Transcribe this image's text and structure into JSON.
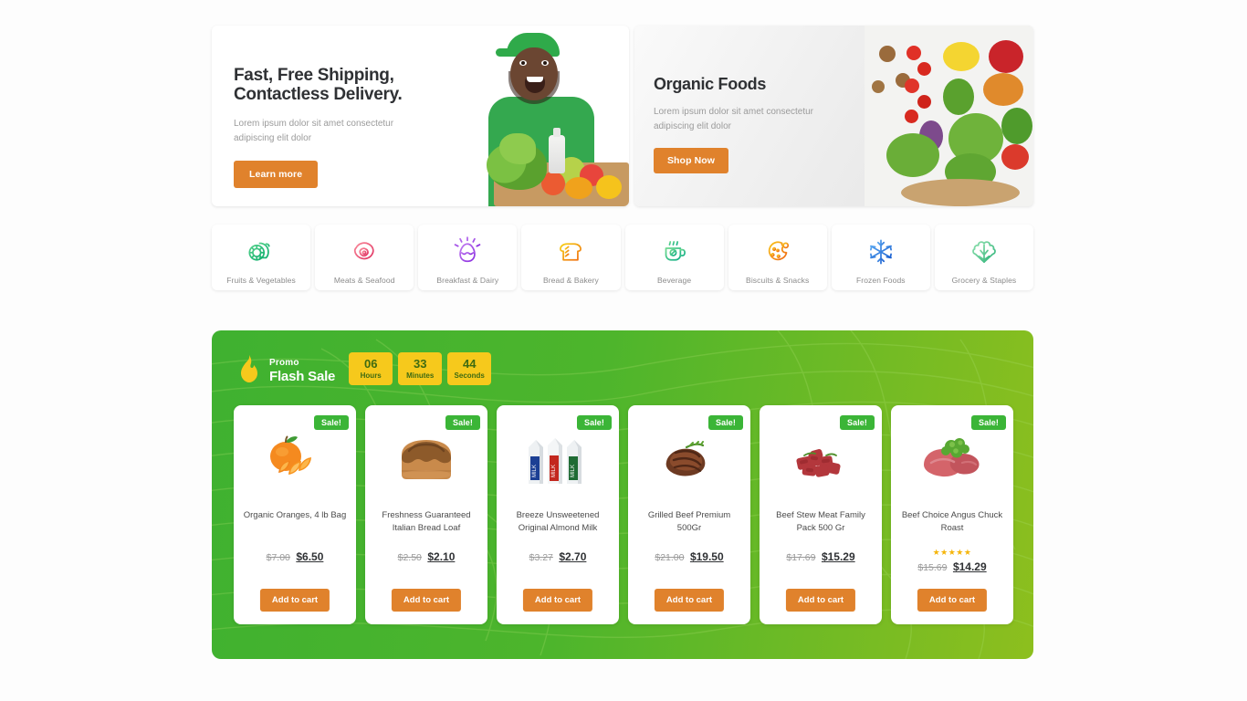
{
  "hero": {
    "left": {
      "title_line1": "Fast, Free Shipping,",
      "title_line2": "Contactless Delivery.",
      "subtitle": "Lorem ipsum dolor sit amet consectetur adipiscing elit dolor",
      "cta": "Learn more"
    },
    "right": {
      "title": "Organic Foods",
      "subtitle": "Lorem ipsum dolor sit amet consectetur adipiscing elit dolor",
      "cta": "Shop Now"
    }
  },
  "categories": [
    {
      "label": "Fruits & Vegetables",
      "icon": "citrus-icon",
      "c1": "#53d08a",
      "c2": "#0fae6e"
    },
    {
      "label": "Meats & Seafood",
      "icon": "steak-icon",
      "c1": "#f98a9a",
      "c2": "#e03362"
    },
    {
      "label": "Breakfast & Dairy",
      "icon": "egg-icon",
      "c1": "#c07af0",
      "c2": "#8b2fe0"
    },
    {
      "label": "Bread & Bakery",
      "icon": "bread-icon",
      "c1": "#f7d117",
      "c2": "#f06c10"
    },
    {
      "label": "Beverage",
      "icon": "coffee-cup-icon",
      "c1": "#6fd98f",
      "c2": "#0fae86"
    },
    {
      "label": "Biscuits & Snacks",
      "icon": "cookie-icon",
      "c1": "#f9c41a",
      "c2": "#ef6a16"
    },
    {
      "label": "Frozen Foods",
      "icon": "snowflake-icon",
      "c1": "#5aa7f0",
      "c2": "#1a5fd0"
    },
    {
      "label": "Grocery & Staples",
      "icon": "leafy-greens-icon",
      "c1": "#8fe0ae",
      "c2": "#2fb37a"
    }
  ],
  "flash_sale": {
    "kicker": "Promo",
    "title": "Flash Sale",
    "icon": "flame-icon",
    "timer": [
      {
        "value": "06",
        "label": "Hours"
      },
      {
        "value": "33",
        "label": "Minutes"
      },
      {
        "value": "44",
        "label": "Seconds"
      }
    ],
    "badge_label": "Sale!",
    "add_to_cart_label": "Add to cart",
    "products": [
      {
        "name": "Organic Oranges, 4 lb Bag",
        "old_price": "$7.00",
        "new_price": "$6.50",
        "image": "oranges-image",
        "rating": 0
      },
      {
        "name": "Freshness Guaranteed Italian Bread Loaf",
        "old_price": "$2.50",
        "new_price": "$2.10",
        "image": "bread-loaf-image",
        "rating": 0
      },
      {
        "name": "Breeze Unsweetened Original Almond Milk",
        "old_price": "$3.27",
        "new_price": "$2.70",
        "image": "almond-milk-cartons-image",
        "rating": 0
      },
      {
        "name": "Grilled Beef Premium 500Gr",
        "old_price": "$21.00",
        "new_price": "$19.50",
        "image": "grilled-beef-image",
        "rating": 0
      },
      {
        "name": "Beef Stew Meat Family Pack 500 Gr",
        "old_price": "$17.69",
        "new_price": "$15.29",
        "image": "beef-stew-meat-image",
        "rating": 0
      },
      {
        "name": "Beef Choice Angus Chuck Roast",
        "old_price": "$15.69",
        "new_price": "$14.29",
        "image": "chuck-roast-image",
        "rating": 5,
        "stars": "★★★★★"
      }
    ]
  },
  "colors": {
    "orange": "#e0822c",
    "green_badge": "#3bb537",
    "banner_green": "#4db52c",
    "banner_yellow_green": "#8dbf1e",
    "timer_yellow": "#f6c91c",
    "star_gold": "#f5b50a"
  }
}
